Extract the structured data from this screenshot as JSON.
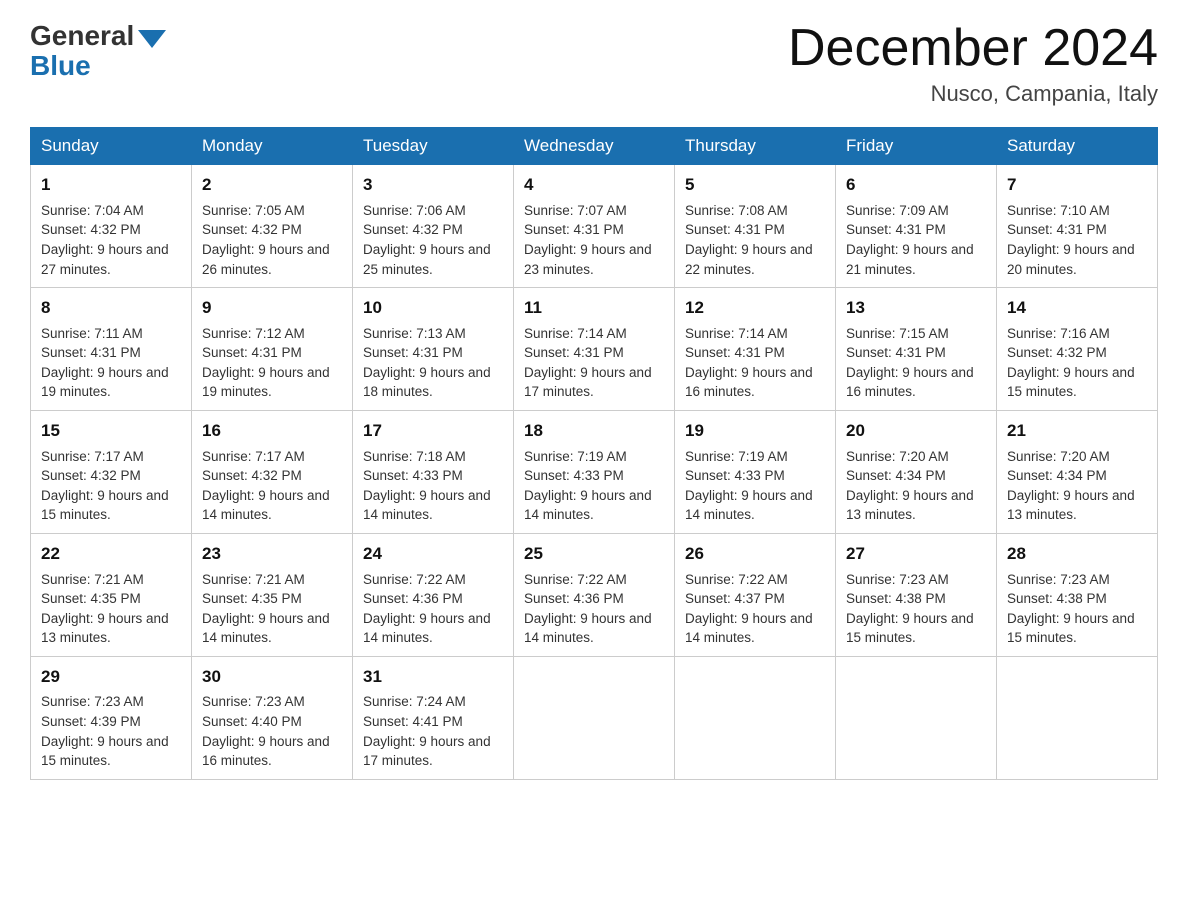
{
  "header": {
    "logo_general": "General",
    "logo_blue": "Blue",
    "month_year": "December 2024",
    "location": "Nusco, Campania, Italy"
  },
  "weekdays": [
    "Sunday",
    "Monday",
    "Tuesday",
    "Wednesday",
    "Thursday",
    "Friday",
    "Saturday"
  ],
  "weeks": [
    [
      {
        "day": "1",
        "sunrise": "7:04 AM",
        "sunset": "4:32 PM",
        "daylight": "9 hours and 27 minutes."
      },
      {
        "day": "2",
        "sunrise": "7:05 AM",
        "sunset": "4:32 PM",
        "daylight": "9 hours and 26 minutes."
      },
      {
        "day": "3",
        "sunrise": "7:06 AM",
        "sunset": "4:32 PM",
        "daylight": "9 hours and 25 minutes."
      },
      {
        "day": "4",
        "sunrise": "7:07 AM",
        "sunset": "4:31 PM",
        "daylight": "9 hours and 23 minutes."
      },
      {
        "day": "5",
        "sunrise": "7:08 AM",
        "sunset": "4:31 PM",
        "daylight": "9 hours and 22 minutes."
      },
      {
        "day": "6",
        "sunrise": "7:09 AM",
        "sunset": "4:31 PM",
        "daylight": "9 hours and 21 minutes."
      },
      {
        "day": "7",
        "sunrise": "7:10 AM",
        "sunset": "4:31 PM",
        "daylight": "9 hours and 20 minutes."
      }
    ],
    [
      {
        "day": "8",
        "sunrise": "7:11 AM",
        "sunset": "4:31 PM",
        "daylight": "9 hours and 19 minutes."
      },
      {
        "day": "9",
        "sunrise": "7:12 AM",
        "sunset": "4:31 PM",
        "daylight": "9 hours and 19 minutes."
      },
      {
        "day": "10",
        "sunrise": "7:13 AM",
        "sunset": "4:31 PM",
        "daylight": "9 hours and 18 minutes."
      },
      {
        "day": "11",
        "sunrise": "7:14 AM",
        "sunset": "4:31 PM",
        "daylight": "9 hours and 17 minutes."
      },
      {
        "day": "12",
        "sunrise": "7:14 AM",
        "sunset": "4:31 PM",
        "daylight": "9 hours and 16 minutes."
      },
      {
        "day": "13",
        "sunrise": "7:15 AM",
        "sunset": "4:31 PM",
        "daylight": "9 hours and 16 minutes."
      },
      {
        "day": "14",
        "sunrise": "7:16 AM",
        "sunset": "4:32 PM",
        "daylight": "9 hours and 15 minutes."
      }
    ],
    [
      {
        "day": "15",
        "sunrise": "7:17 AM",
        "sunset": "4:32 PM",
        "daylight": "9 hours and 15 minutes."
      },
      {
        "day": "16",
        "sunrise": "7:17 AM",
        "sunset": "4:32 PM",
        "daylight": "9 hours and 14 minutes."
      },
      {
        "day": "17",
        "sunrise": "7:18 AM",
        "sunset": "4:33 PM",
        "daylight": "9 hours and 14 minutes."
      },
      {
        "day": "18",
        "sunrise": "7:19 AM",
        "sunset": "4:33 PM",
        "daylight": "9 hours and 14 minutes."
      },
      {
        "day": "19",
        "sunrise": "7:19 AM",
        "sunset": "4:33 PM",
        "daylight": "9 hours and 14 minutes."
      },
      {
        "day": "20",
        "sunrise": "7:20 AM",
        "sunset": "4:34 PM",
        "daylight": "9 hours and 13 minutes."
      },
      {
        "day": "21",
        "sunrise": "7:20 AM",
        "sunset": "4:34 PM",
        "daylight": "9 hours and 13 minutes."
      }
    ],
    [
      {
        "day": "22",
        "sunrise": "7:21 AM",
        "sunset": "4:35 PM",
        "daylight": "9 hours and 13 minutes."
      },
      {
        "day": "23",
        "sunrise": "7:21 AM",
        "sunset": "4:35 PM",
        "daylight": "9 hours and 14 minutes."
      },
      {
        "day": "24",
        "sunrise": "7:22 AM",
        "sunset": "4:36 PM",
        "daylight": "9 hours and 14 minutes."
      },
      {
        "day": "25",
        "sunrise": "7:22 AM",
        "sunset": "4:36 PM",
        "daylight": "9 hours and 14 minutes."
      },
      {
        "day": "26",
        "sunrise": "7:22 AM",
        "sunset": "4:37 PM",
        "daylight": "9 hours and 14 minutes."
      },
      {
        "day": "27",
        "sunrise": "7:23 AM",
        "sunset": "4:38 PM",
        "daylight": "9 hours and 15 minutes."
      },
      {
        "day": "28",
        "sunrise": "7:23 AM",
        "sunset": "4:38 PM",
        "daylight": "9 hours and 15 minutes."
      }
    ],
    [
      {
        "day": "29",
        "sunrise": "7:23 AM",
        "sunset": "4:39 PM",
        "daylight": "9 hours and 15 minutes."
      },
      {
        "day": "30",
        "sunrise": "7:23 AM",
        "sunset": "4:40 PM",
        "daylight": "9 hours and 16 minutes."
      },
      {
        "day": "31",
        "sunrise": "7:24 AM",
        "sunset": "4:41 PM",
        "daylight": "9 hours and 17 minutes."
      },
      {
        "day": "",
        "sunrise": "",
        "sunset": "",
        "daylight": ""
      },
      {
        "day": "",
        "sunrise": "",
        "sunset": "",
        "daylight": ""
      },
      {
        "day": "",
        "sunrise": "",
        "sunset": "",
        "daylight": ""
      },
      {
        "day": "",
        "sunrise": "",
        "sunset": "",
        "daylight": ""
      }
    ]
  ]
}
